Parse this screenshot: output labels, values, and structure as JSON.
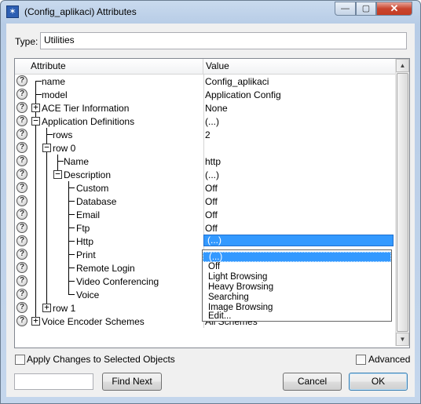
{
  "window": {
    "title": "(Config_aplikaci) Attributes",
    "controls": {
      "minimize": "—",
      "maximize": "▢",
      "close": "✕"
    }
  },
  "type_field": {
    "label": "Type:",
    "value": "Utilities"
  },
  "grid": {
    "columns": {
      "attribute": "Attribute",
      "value": "Value"
    },
    "rows": [
      {
        "label": "name",
        "value": "Config_aplikaci"
      },
      {
        "label": "model",
        "value": "Application Config"
      },
      {
        "label": "ACE Tier Information",
        "value": "None",
        "toggle": "+"
      },
      {
        "label": "Application Definitions",
        "value": "(...)",
        "toggle": "−"
      },
      {
        "label": "rows",
        "value": "2"
      },
      {
        "label": "row 0",
        "value": "",
        "toggle": "−"
      },
      {
        "label": "Name",
        "value": "http"
      },
      {
        "label": "Description",
        "value": "(...)",
        "toggle": "−"
      },
      {
        "label": "Custom",
        "value": "Off"
      },
      {
        "label": "Database",
        "value": "Off"
      },
      {
        "label": "Email",
        "value": "Off"
      },
      {
        "label": "Ftp",
        "value": "Off"
      },
      {
        "label": "Http",
        "value": "(...)"
      },
      {
        "label": "Print",
        "value": ""
      },
      {
        "label": "Remote Login",
        "value": ""
      },
      {
        "label": "Video Conferencing",
        "value": ""
      },
      {
        "label": "Voice",
        "value": ""
      },
      {
        "label": "row 1",
        "value": "",
        "toggle": "+"
      },
      {
        "label": "Voice Encoder Schemes",
        "value": "All Schemes",
        "toggle": "+"
      }
    ],
    "help_glyph": "?"
  },
  "dropdown": {
    "options": [
      "(...)",
      "Off",
      "Light Browsing",
      "Heavy Browsing",
      "Searching",
      "Image Browsing",
      "Edit..."
    ],
    "selected": "(...)"
  },
  "footer": {
    "apply_label": "Apply Changes to Selected Objects",
    "advanced_label": "Advanced",
    "find_value": "",
    "find_next_label": "Find Next",
    "cancel_label": "Cancel",
    "ok_label": "OK"
  },
  "icons": {
    "app_icon": "star-icon",
    "help_icon": "question-mark-icon"
  }
}
